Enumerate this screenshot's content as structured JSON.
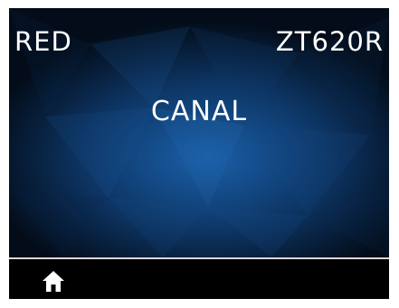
{
  "header": {
    "left_label": "RED",
    "right_label": "ZT620R"
  },
  "main": {
    "menu_label": "CANAL"
  },
  "footer": {
    "home_icon": "home-icon"
  },
  "colors": {
    "background": "#000000",
    "display_center": "#1a5fa8",
    "text": "#ffffff",
    "divider": "#d9d9d9"
  }
}
